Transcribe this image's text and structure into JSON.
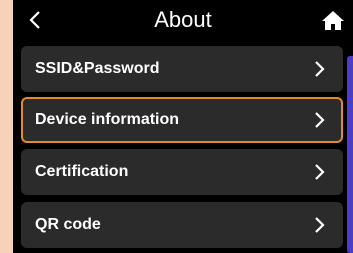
{
  "header": {
    "title": "About",
    "back_icon": "chevron-left-icon",
    "home_icon": "home-icon"
  },
  "menu": {
    "items": [
      {
        "label": "SSID&Password",
        "icon": "chevron-right-icon"
      },
      {
        "label": "Device information",
        "icon": "chevron-right-icon",
        "selected": true
      },
      {
        "label": "Certification",
        "icon": "chevron-right-icon"
      },
      {
        "label": "QR code",
        "icon": "chevron-right-icon"
      }
    ]
  },
  "colors": {
    "background": "#000000",
    "item_background": "#2b2b2b",
    "selected_border": "#e48a2a",
    "side_accent": "#4b3dc5",
    "outer_background": "#f7d2b8"
  }
}
